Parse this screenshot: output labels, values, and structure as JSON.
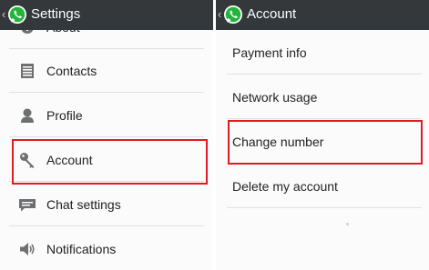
{
  "left_panel": {
    "title": "Settings",
    "items": [
      {
        "label": "About",
        "icon": "info-icon"
      },
      {
        "label": "Contacts",
        "icon": "contacts-icon"
      },
      {
        "label": "Profile",
        "icon": "profile-icon"
      },
      {
        "label": "Account",
        "icon": "key-icon"
      },
      {
        "label": "Chat settings",
        "icon": "chat-icon"
      },
      {
        "label": "Notifications",
        "icon": "speaker-icon"
      }
    ]
  },
  "right_panel": {
    "title": "Account",
    "items": [
      {
        "label": "Payment info"
      },
      {
        "label": "Network usage"
      },
      {
        "label": "Change number"
      },
      {
        "label": "Delete my account"
      }
    ]
  },
  "colors": {
    "action_bar": "#34383b",
    "highlight": "#e01b22",
    "whatsapp_green": "#25b43d"
  }
}
